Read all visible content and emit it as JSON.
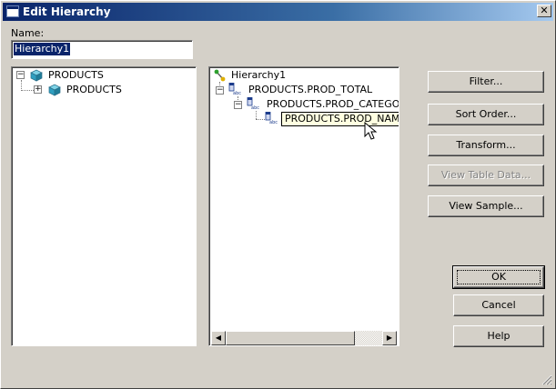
{
  "window": {
    "title": "Edit Hierarchy",
    "close_glyph": "✕"
  },
  "name_field": {
    "label": "Name:",
    "value": "Hierarchy1"
  },
  "source_tree": {
    "root": {
      "label": "PRODUCTS",
      "expander": "−",
      "icon": "cube-icon"
    },
    "children": [
      {
        "label": "PRODUCTS",
        "expander": "+",
        "icon": "cube-icon"
      }
    ]
  },
  "hierarchy_tree": {
    "root": {
      "label": "Hierarchy1",
      "icon": "hierarchy-icon"
    },
    "levels": [
      {
        "label": "PRODUCTS.PROD_TOTAL",
        "expander": "−",
        "icon": "column-abc-icon"
      },
      {
        "label": "PRODUCTS.PROD_CATEGO",
        "expander": "−",
        "icon": "column-abc-icon"
      },
      {
        "label": "",
        "icon": "column-abc-icon"
      }
    ],
    "tooltip": "PRODUCTS.PROD_NAME"
  },
  "scrollbar": {
    "left_arrow": "◀",
    "right_arrow": "▶"
  },
  "buttons": {
    "filter": "Filter...",
    "sort_order": "Sort Order...",
    "transform": "Transform...",
    "view_table_data": "View Table Data...",
    "view_sample": "View Sample...",
    "ok": "OK",
    "cancel": "Cancel",
    "help": "Help"
  },
  "colors": {
    "title_bar": "#0a246a",
    "dialog_bg": "#d4d0c8",
    "selection": "#0a246a",
    "tooltip_bg": "#ffffe1"
  }
}
